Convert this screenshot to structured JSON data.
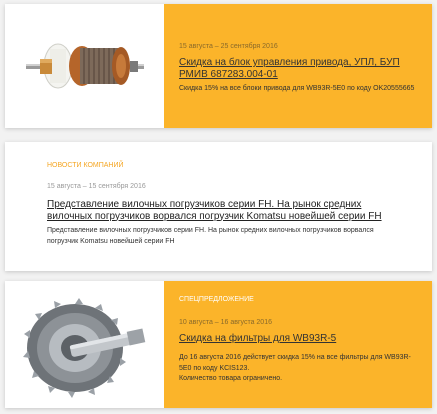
{
  "cards": [
    {
      "category": "",
      "date": "15 августа – 25 сентября 2016",
      "title": "Скидка на блок управления привода, УПЛ, БУП РМИВ 687283.004-01",
      "desc": [
        "Скидка 15% на все блоки привода для WB93R-5E0 по коду OK20555665"
      ]
    },
    {
      "category": "НОВОСТИ КОМПАНИЙ",
      "date": "15 августа – 15 сентября 2016",
      "title": "Представление вилочных погрузчиков серии FH. На рынок средних вилочных погрузчиков ворвался погрузчик Komatsu новейшей серии FH",
      "desc": [
        "Представление вилочных погрузчиков серии FH. На рынок средних вилочных погрузчиков ворвался погрузчик Komatsu новейшей серии FH"
      ]
    },
    {
      "category": "СПЕЦПРЕДЛОЖЕНИЕ",
      "date": "10 августа – 16 августа 2016",
      "title": "Скидка на фильтры для WB93R-5",
      "desc": [
        "До 16 августа 2016 действует скидка 15% на все фильтры для WB93R-5E0 по коду KCIS123.",
        "Количество товара ограничено."
      ]
    }
  ],
  "icons": {
    "card1_image": "armature-motor-icon",
    "card3_image": "bevel-gear-icon"
  },
  "colors": {
    "accent": "#fbb42a",
    "category_on_white": "#f5a623",
    "page_background": "#f2f2f2"
  }
}
